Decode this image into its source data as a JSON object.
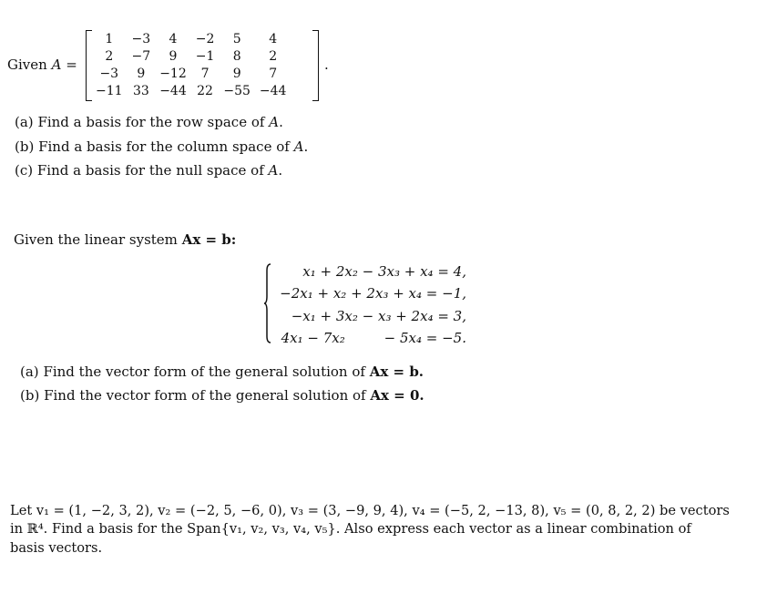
{
  "problem1": {
    "given_prefix": "Given",
    "matrix_name": "A",
    "equals": "=",
    "matrix": [
      [
        "1",
        "−3",
        "4",
        "−2",
        "5",
        "4"
      ],
      [
        "2",
        "−7",
        "9",
        "−1",
        "8",
        "2"
      ],
      [
        "−3",
        "9",
        "−12",
        "7",
        "9",
        "7"
      ],
      [
        "−11",
        "33",
        "−44",
        "22",
        "−55",
        "−44"
      ]
    ],
    "period": ".",
    "parts": [
      {
        "label": "(a)",
        "text": "Find a basis for the row space of",
        "var": "A",
        "end": "."
      },
      {
        "label": "(b)",
        "text": "Find a basis for the column space of",
        "var": "A",
        "end": "."
      },
      {
        "label": "(c)",
        "text": "Find a basis for the null space of",
        "var": "A",
        "end": "."
      }
    ]
  },
  "problem2": {
    "intro_text": "Given the linear system",
    "intro_math": "Ax = b:",
    "equations": [
      "x₁ + 2x₂ − 3x₃ + x₄ = 4,",
      "−2x₁ + x₂ + 2x₃ + x₄ = −1,",
      "−x₁ + 3x₂ − x₃ + 2x₄ = 3,",
      "4x₁ − 7x₂         − 5x₄ = −5."
    ],
    "parts": [
      {
        "label": "(a)",
        "text": "Find the vector form of the general solution of",
        "math": "Ax = b."
      },
      {
        "label": "(b)",
        "text": "Find the vector form of the general solution of",
        "math": "Ax = 0."
      }
    ]
  },
  "problem3": {
    "line1": "Let v₁ = (1, −2, 3, 2), v₂ = (−2, 5, −6, 0), v₃ = (3, −9, 9, 4), v₄ = (−5, 2, −13, 8), v₅ = (0, 8, 2, 2) be vectors",
    "line2": "in ℝ⁴.  Find a basis for the Span{v₁, v₂, v₃, v₄, v₅}.  Also express each vector as a linear combination of",
    "line3": "basis vectors."
  }
}
